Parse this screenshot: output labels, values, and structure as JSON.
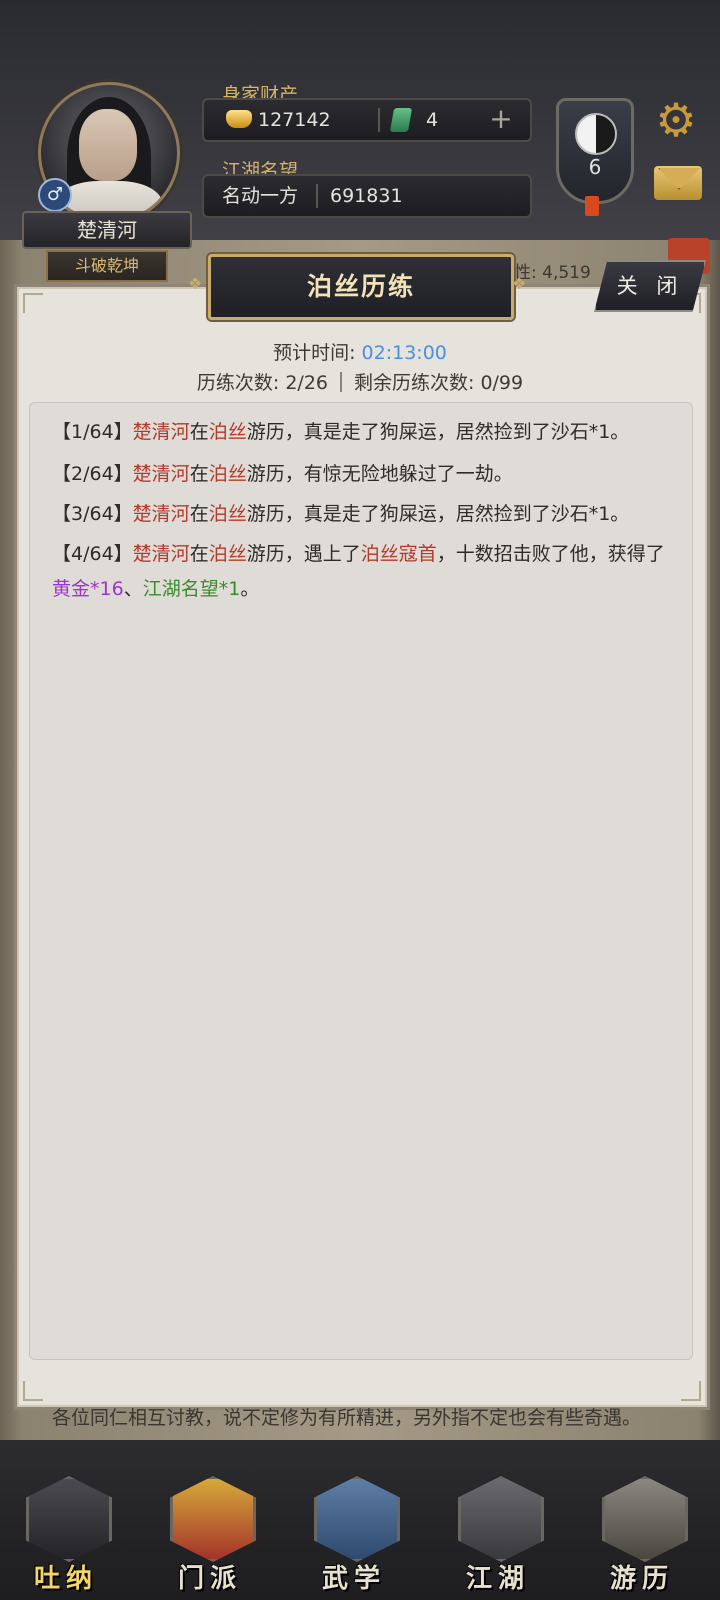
{
  "player": {
    "name": "楚清河",
    "title": "斗破乾坤",
    "gender_symbol": "♂"
  },
  "wealth": {
    "label": "身家财产",
    "gold": "127142",
    "jade": "4",
    "plus": "+"
  },
  "reputation": {
    "label": "江湖名望",
    "rank": "名动一方",
    "value": "691831"
  },
  "badge": {
    "level": "6"
  },
  "background_peek": {
    "attr_text": "性: 4,519"
  },
  "dialog": {
    "title": "泊丝历练",
    "close_label": "关 闭",
    "eta_label": "预计时间:",
    "eta_value": "02:13:00",
    "count_label": "历练次数: 2/26",
    "remaining_label": "剩余历练次数: 0/99",
    "log": [
      {
        "idx": "【1/64】",
        "name": "楚清河",
        "mid1": "在",
        "place": "泊丝",
        "text": "游历，真是走了狗屎运，居然捡到了沙石*1。"
      },
      {
        "idx": "【2/64】",
        "name": "楚清河",
        "mid1": "在",
        "place": "泊丝",
        "text": "游历，有惊无险地躲过了一劫。"
      },
      {
        "idx": "【3/64】",
        "name": "楚清河",
        "mid1": "在",
        "place": "泊丝",
        "text": "游历，真是走了狗屎运，居然捡到了沙石*1。"
      },
      {
        "idx": "【4/64】",
        "name": "楚清河",
        "mid1": "在",
        "place": "泊丝",
        "text": "游历，遇上了",
        "enemy": "泊丝寇首",
        "text2": "，十数招击败了他，获得了",
        "reward1": "黄金",
        "r1q": "*16",
        "sep": "、",
        "reward2": "江湖名望",
        "r2q": "*1",
        "end": "。"
      }
    ]
  },
  "bottom_text": "各位同仁相互讨教，说不定修为有所精进，另外指不定也会有些奇遇。",
  "nav": [
    {
      "label": "吐纳"
    },
    {
      "label": "门派"
    },
    {
      "label": "武学"
    },
    {
      "label": "江湖"
    },
    {
      "label": "游历"
    }
  ]
}
